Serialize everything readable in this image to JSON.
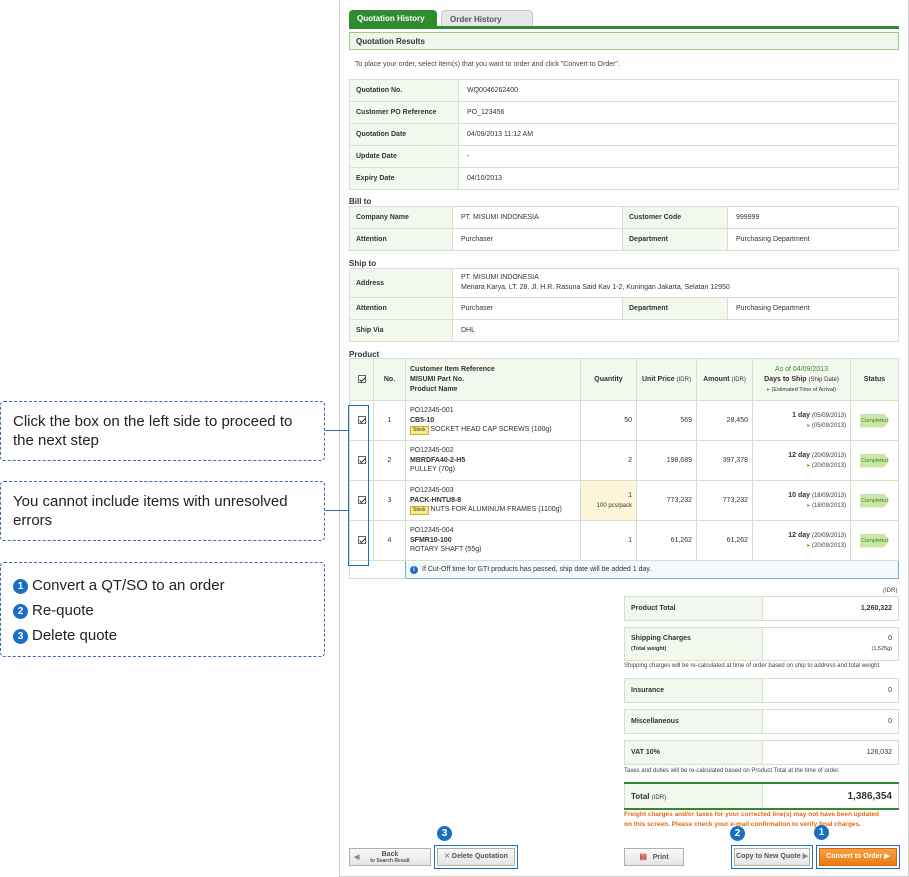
{
  "tabs": {
    "quotation_history": "Quotation History",
    "order_history": "Order History"
  },
  "section_title": "Quotation Results",
  "instruction": "To place your order, select item(s) that you want to order and click \"Convert to Order\".",
  "quote_info": [
    {
      "label": "Quotation No.",
      "value": "WQ0046262400"
    },
    {
      "label": "Customer PO Reference",
      "value": "PO_123456"
    },
    {
      "label": "Quotation Date",
      "value": "04/09/2013 11:12 AM"
    },
    {
      "label": "Update Date",
      "value": "-"
    },
    {
      "label": "Expiry Date",
      "value": "04/10/2013"
    }
  ],
  "bill_to": {
    "title": "Bill to",
    "company_label": "Company Name",
    "company": "PT. MISUMI INDONESIA",
    "code_label": "Customer Code",
    "code": "999999",
    "attention_label": "Attention",
    "attention": "Purchaser",
    "dept_label": "Department",
    "dept": "Purchasing Department"
  },
  "ship_to": {
    "title": "Ship to",
    "address_label": "Address",
    "address_1": "PT. MISUMI INDONESIA",
    "address_2": "Menara Karya, LT. 28. Jl. H.R. Rasuna Said Kav 1-2, Kuningan Jakarta, Selatan 12950",
    "attention_label": "Attention",
    "attention": "Purchaser",
    "dept_label": "Department",
    "dept": "Purchasing Department",
    "shipvia_label": "Ship Via",
    "shipvia": "DHL"
  },
  "product": {
    "title": "Product",
    "headers": {
      "no": "No.",
      "ref1": "Customer Item Reference",
      "ref2": "MISUMI Part No.",
      "ref3": "Product Name",
      "qty": "Quantity",
      "unit_price": "Unit Price",
      "unit_price_cur": "(IDR)",
      "amount": "Amount",
      "amount_cur": "(IDR)",
      "asof": "As of 04/09/2013",
      "days": "Days to Ship",
      "days_sub": "(Ship Date)",
      "eta_label": "(Estimated Time of Arrival)",
      "status": "Status"
    },
    "rows": [
      {
        "no": "1",
        "ref": "PO12345-001",
        "part": "CB5-10",
        "stock": "Stock",
        "name": "SOCKET HEAD CAP SCREWS (100g)",
        "qty": "50",
        "qty_note": "",
        "unit": "569",
        "amount": "28,450",
        "days": "1 day",
        "ship": "(05/09/2013)",
        "eta": "(05/09/2013)",
        "status": "Completed"
      },
      {
        "no": "2",
        "ref": "PO12345-002",
        "part": "MBRDFA40-2-H5",
        "stock": "",
        "name": "PULLEY (70g)",
        "qty": "2",
        "qty_note": "",
        "unit": "198,689",
        "amount": "397,378",
        "days": "12 day",
        "ship": "(20/09/2013)",
        "eta": "(20/09/2013)",
        "status": "Completed"
      },
      {
        "no": "3",
        "ref": "PO12345-003",
        "part": "PACK-HNTU8-8",
        "stock": "Stock",
        "name": "NUTS FOR ALUMINUM FRAMES (1100g)",
        "qty": "1",
        "qty_note": "100 pcs/pack",
        "unit": "773,232",
        "amount": "773,232",
        "days": "10 day",
        "ship": "(18/09/2013)",
        "eta": "(18/09/2013)",
        "status": "Completed"
      },
      {
        "no": "4",
        "ref": "PO12345-004",
        "part": "SFMR10-100",
        "stock": "",
        "name": "ROTARY SHAFT (55g)",
        "qty": "1",
        "qty_note": "",
        "unit": "61,262",
        "amount": "61,262",
        "days": "12 day",
        "ship": "(20/09/2013)",
        "eta": "(20/09/2013)",
        "status": "Completed"
      }
    ],
    "cutoff_note": "If Cut-Off time for GTI products has passed, ship date will be added 1 day."
  },
  "summary": {
    "currency": "(IDR)",
    "product_total_label": "Product Total",
    "product_total": "1,260,322",
    "shipping_label": "Shipping Charges",
    "shipping_sub": "(Total weight)",
    "shipping": "0",
    "weight": "(1,525g)",
    "shipping_note": "Shipping charges will be re-calculated at time of order based on ship to address and total weight.",
    "insurance_label": "Insurance",
    "insurance": "0",
    "misc_label": "Miscellaneous",
    "misc": "0",
    "vat_label": "VAT 10%",
    "vat": "126,032",
    "tax_note": "Taxes and duties will be re-calculated based on Product Total at the time of order.",
    "total_label": "Total",
    "total_cur": "(IDR)",
    "total": "1,386,354",
    "warning_1": "Freight charges and/or taxes for your corrected line(s) may not have been updated",
    "warning_2": "on this screen. Please check your e-mail confirmation to verify final charges."
  },
  "buttons": {
    "back": "Back",
    "back_sub": "to Search Result",
    "delete": "Delete Quotation",
    "print": "Print",
    "copy": "Copy to New Quote",
    "convert": "Convert to Order"
  },
  "callouts": {
    "c1": "Click the box on the left side to proceed to the next step",
    "c2": "You cannot include items with unresolved errors",
    "c3_1": "Convert a QT/SO to an order",
    "c3_2": "Re-quote",
    "c3_3": "Delete quote",
    "n1": "1",
    "n2": "2",
    "n3": "3"
  }
}
